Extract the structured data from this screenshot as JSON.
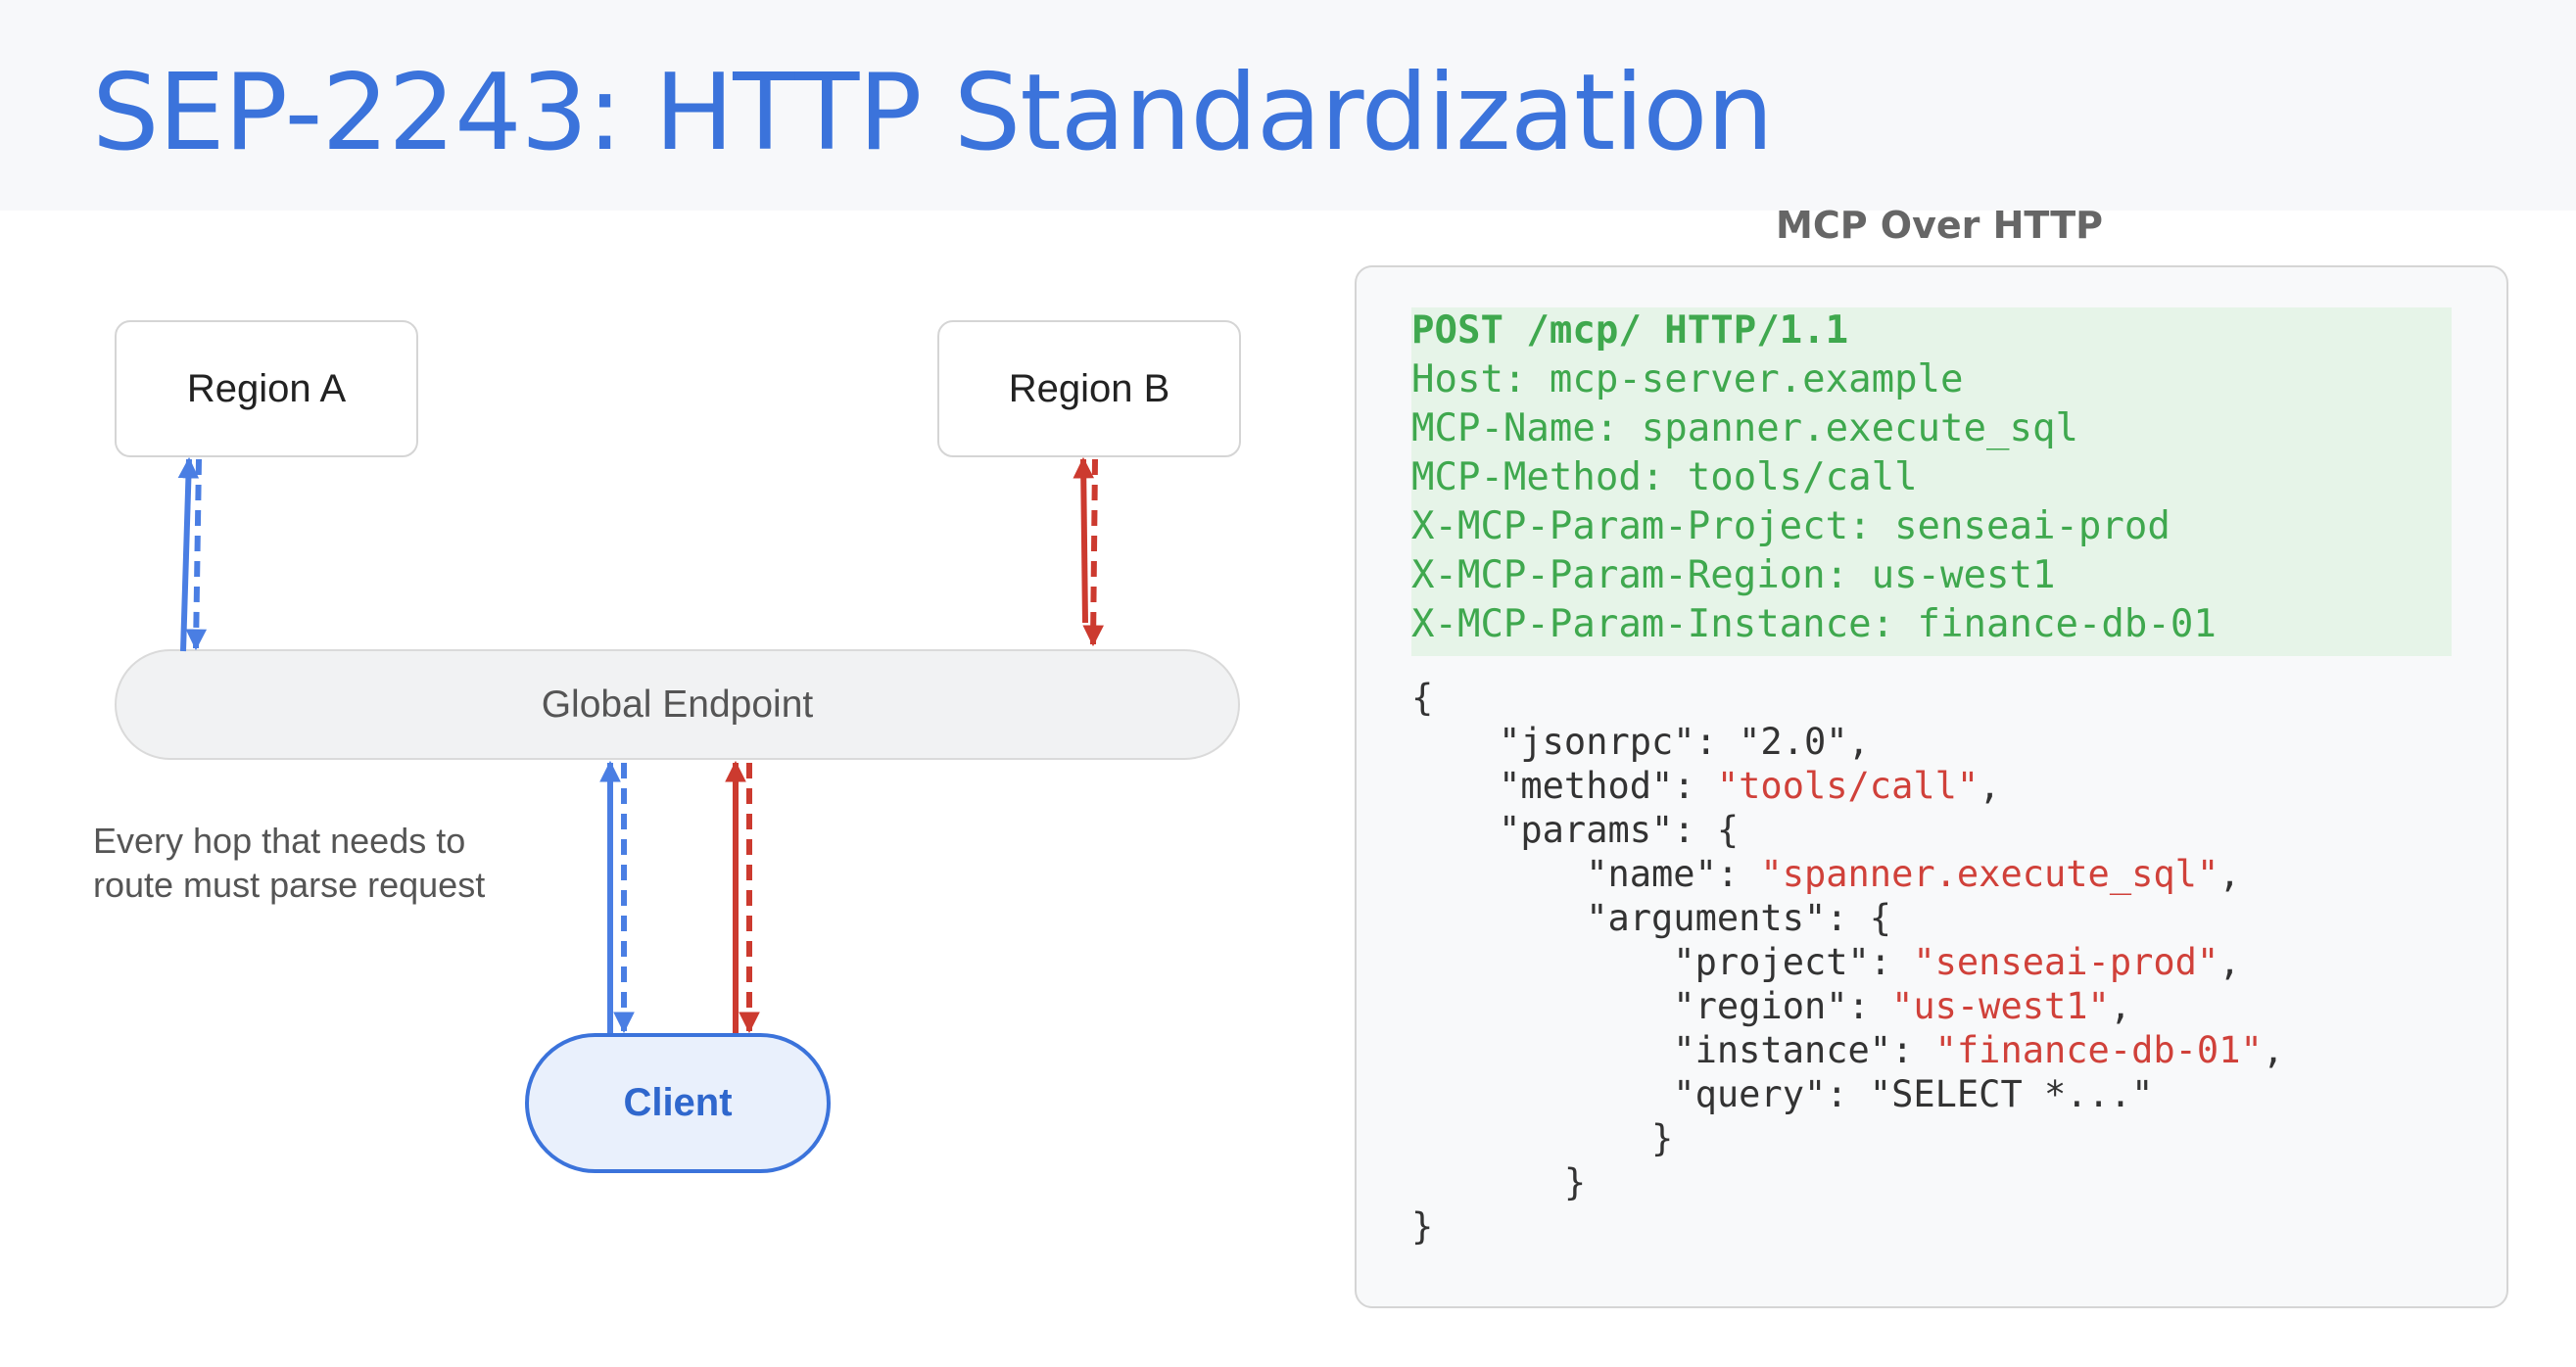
{
  "title": "SEP-2243: HTTP Standardization",
  "diagram": {
    "region_a": "Region A",
    "region_b": "Region B",
    "global_endpoint": "Global Endpoint",
    "client": "Client",
    "note_line1": "Every hop that needs to",
    "note_line2": "route must parse request",
    "colors": {
      "blue": "#4a7ee3",
      "red": "#cc3a2f"
    }
  },
  "panel": {
    "title": "MCP Over HTTP",
    "request_line": "POST /mcp/ HTTP/1.1",
    "headers": [
      "Host: mcp-server.example",
      "MCP-Name: spanner.execute_sql",
      "MCP-Method: tools/call",
      "X-MCP-Param-Project: senseai-prod",
      "X-MCP-Param-Region: us-west1",
      "X-MCP-Param-Instance: finance-db-01"
    ],
    "body": {
      "open": "{",
      "jsonrpc_key": "    \"jsonrpc\": ",
      "jsonrpc_val": "\"2.0\",",
      "method_key": "    \"method\": ",
      "method_val": "\"tools/call\"",
      "params_key": "    \"params\": {",
      "name_key": "        \"name\": ",
      "name_val": "\"spanner.execute_sql\"",
      "arguments_key": "        \"arguments\": {",
      "project_key": "            \"project\": ",
      "project_val": "\"senseai-prod\"",
      "region_key": "            \"region\": ",
      "region_val": "\"us-west1\"",
      "instance_key": "            \"instance\": ",
      "instance_val": "\"finance-db-01\"",
      "query_line": "            \"query\": \"SELECT *...\"",
      "close_args": "           }",
      "close_params": "       }",
      "close": "}"
    }
  }
}
